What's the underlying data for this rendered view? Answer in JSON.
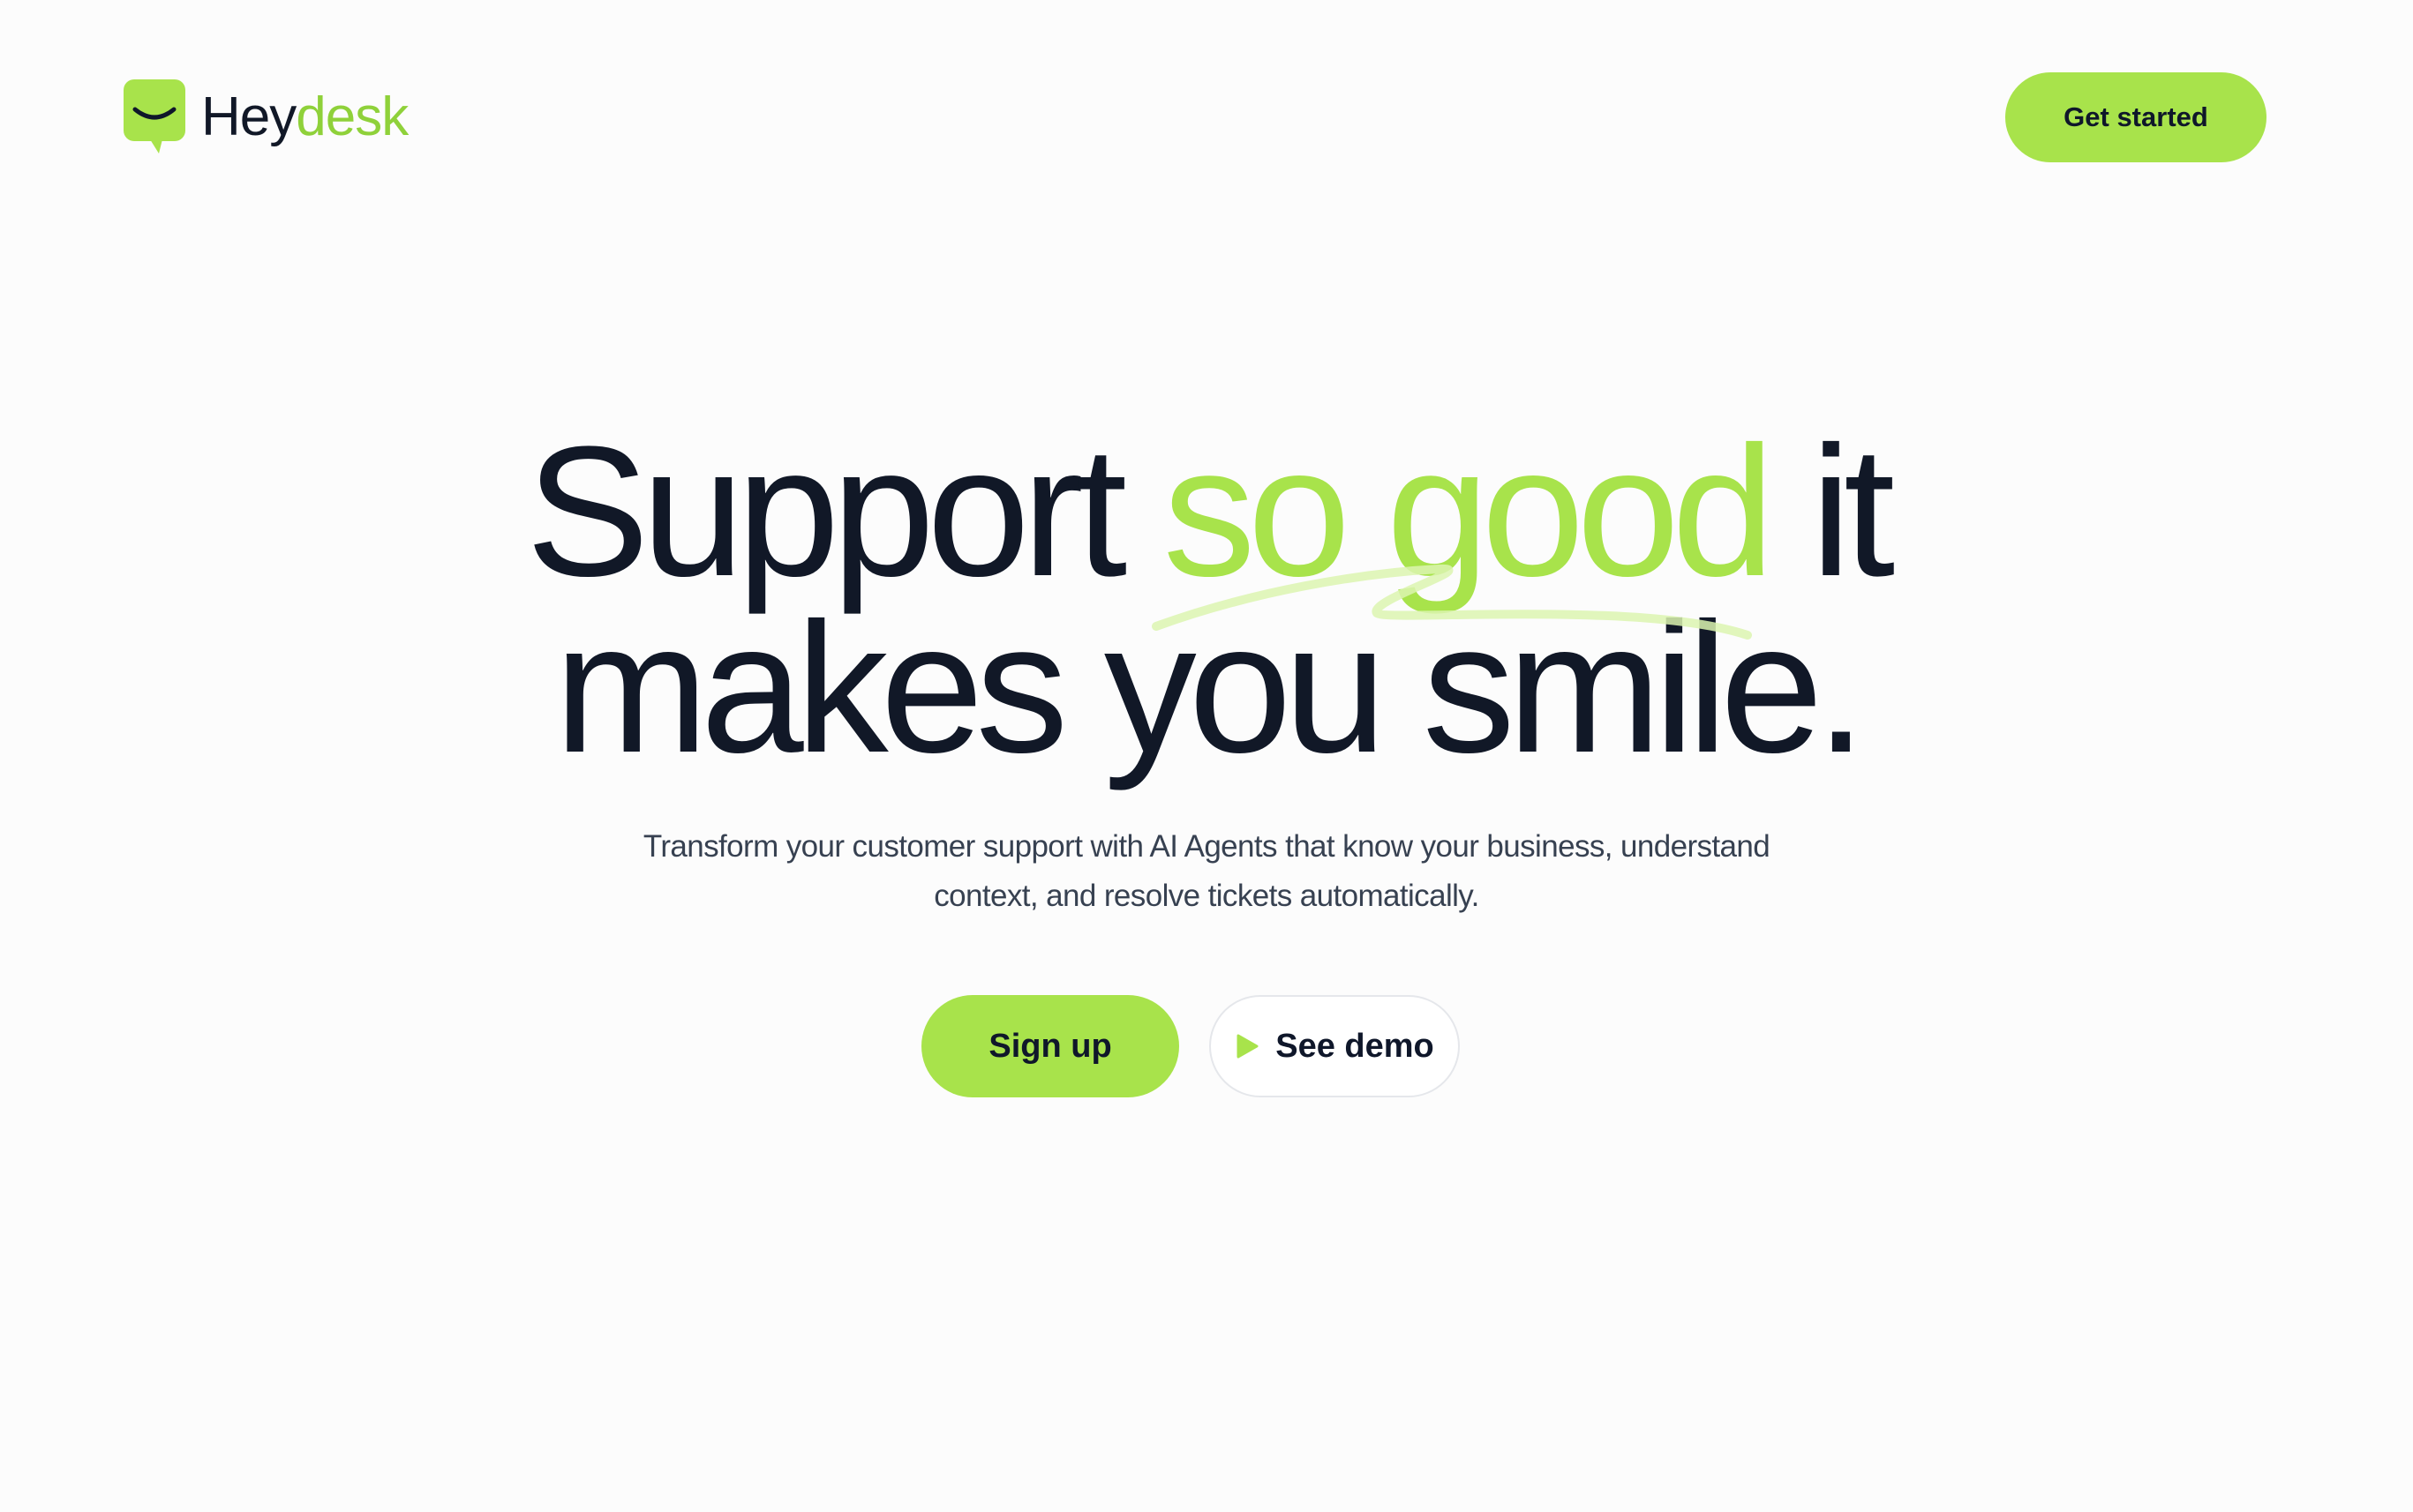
{
  "brand": {
    "name_part1": "Hey",
    "name_part2": "desk",
    "accent_color": "#a8e34b"
  },
  "header": {
    "cta_label": "Get started"
  },
  "hero": {
    "title_part1": "Support ",
    "title_accent": "so good",
    "title_part2": " it",
    "title_line2": "makes you smile.",
    "subtitle_line1": "Transform your customer support with AI Agents that know your business, understand",
    "subtitle_line2": "context, and resolve tickets automatically."
  },
  "cta": {
    "primary_label": "Sign up",
    "secondary_label": "See demo",
    "secondary_icon": "play-icon"
  },
  "colors": {
    "text_dark": "#111827",
    "accent_green": "#a8e34b",
    "background": "#fcfcfc"
  }
}
